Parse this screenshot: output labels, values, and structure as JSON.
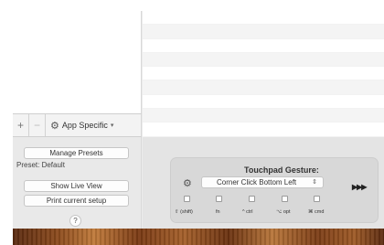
{
  "sidebar": {
    "add_label": "+",
    "remove_label": "−",
    "app_specific_label": "App Specific",
    "manage_presets_label": "Manage Presets",
    "preset_label": "Preset: Default",
    "show_live_view_label": "Show Live View",
    "print_setup_label": "Print current setup",
    "help_label": "?"
  },
  "gesture": {
    "title": "Touchpad Gesture:",
    "selected": "Corner Click Bottom Left",
    "arrows": "▶▶▶",
    "modifiers": [
      "⇧ (shift)",
      "fn",
      "^ ctrl",
      "⌥ opt",
      "⌘ cmd"
    ]
  },
  "icons": {
    "gear": "gear-icon",
    "caret": "chevron-down-icon",
    "select_arrows": "up-down-arrows-icon"
  }
}
